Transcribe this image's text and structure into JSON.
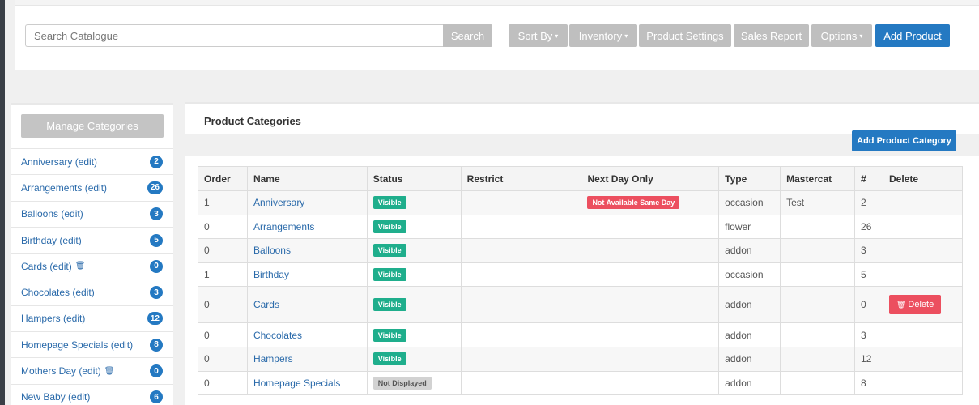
{
  "toolbar": {
    "search_placeholder": "Search Catalogue",
    "search_label": "Search",
    "sort_label": "Sort By",
    "inventory_label": "Inventory",
    "product_settings_label": "Product Settings",
    "sales_report_label": "Sales Report",
    "options_label": "Options",
    "add_product_label": "Add Product",
    "caret": "▾"
  },
  "sidebar": {
    "manage_label": "Manage Categories",
    "items": [
      {
        "label": "Anniversary (edit)",
        "count": "2",
        "trash": false
      },
      {
        "label": "Arrangements (edit)",
        "count": "26",
        "trash": false
      },
      {
        "label": "Balloons (edit)",
        "count": "3",
        "trash": false
      },
      {
        "label": "Birthday (edit)",
        "count": "5",
        "trash": false
      },
      {
        "label": "Cards (edit)",
        "count": "0",
        "trash": true
      },
      {
        "label": "Chocolates (edit)",
        "count": "3",
        "trash": false
      },
      {
        "label": "Hampers (edit)",
        "count": "12",
        "trash": false
      },
      {
        "label": "Homepage Specials (edit)",
        "count": "8",
        "trash": false
      },
      {
        "label": "Mothers Day (edit)",
        "count": "0",
        "trash": true
      },
      {
        "label": "New Baby (edit)",
        "count": "6",
        "trash": false
      }
    ]
  },
  "main": {
    "title": "Product Categories",
    "add_category_label": "Add Product Category",
    "columns": [
      "Order",
      "Name",
      "Status",
      "Restrict",
      "Next Day Only",
      "Type",
      "Mastercat",
      "#",
      "Delete"
    ],
    "rows": [
      {
        "order": "1",
        "name": "Anniversary",
        "status": "Visible",
        "restrict": "",
        "next_day": "Not Available Same Day",
        "type": "occasion",
        "mastercat": "Test",
        "count": "2",
        "delete": ""
      },
      {
        "order": "0",
        "name": "Arrangements",
        "status": "Visible",
        "restrict": "",
        "next_day": "",
        "type": "flower",
        "mastercat": "",
        "count": "26",
        "delete": ""
      },
      {
        "order": "0",
        "name": "Balloons",
        "status": "Visible",
        "restrict": "",
        "next_day": "",
        "type": "addon",
        "mastercat": "",
        "count": "3",
        "delete": ""
      },
      {
        "order": "1",
        "name": "Birthday",
        "status": "Visible",
        "restrict": "",
        "next_day": "",
        "type": "occasion",
        "mastercat": "",
        "count": "5",
        "delete": ""
      },
      {
        "order": "0",
        "name": "Cards",
        "status": "Visible",
        "restrict": "",
        "next_day": "",
        "type": "addon",
        "mastercat": "",
        "count": "0",
        "delete": "Delete"
      },
      {
        "order": "0",
        "name": "Chocolates",
        "status": "Visible",
        "restrict": "",
        "next_day": "",
        "type": "addon",
        "mastercat": "",
        "count": "3",
        "delete": ""
      },
      {
        "order": "0",
        "name": "Hampers",
        "status": "Visible",
        "restrict": "",
        "next_day": "",
        "type": "addon",
        "mastercat": "",
        "count": "12",
        "delete": ""
      },
      {
        "order": "0",
        "name": "Homepage Specials",
        "status": "Not Displayed",
        "restrict": "",
        "next_day": "",
        "type": "addon",
        "mastercat": "",
        "count": "8",
        "delete": ""
      }
    ]
  },
  "colors": {
    "primary": "#2479c2",
    "visible": "#1fae8c",
    "danger": "#ec4f5f",
    "muted_button": "#bfbfbf"
  }
}
